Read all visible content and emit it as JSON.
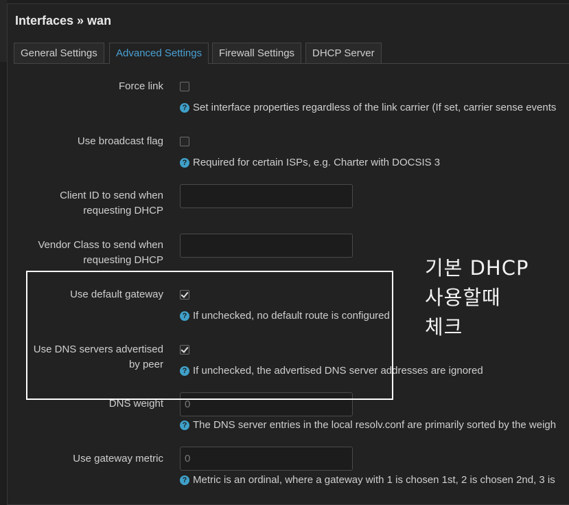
{
  "dialog": {
    "title": "Interfaces » wan"
  },
  "tabs": [
    {
      "label": "General Settings",
      "active": false
    },
    {
      "label": "Advanced Settings",
      "active": true
    },
    {
      "label": "Firewall Settings",
      "active": false
    },
    {
      "label": "DHCP Server",
      "active": false
    }
  ],
  "fields": {
    "force_link": {
      "label": "Force link",
      "checked": false,
      "help": "Set interface properties regardless of the link carrier (If set, carrier sense events"
    },
    "broadcast_flag": {
      "label": "Use broadcast flag",
      "checked": false,
      "help": "Required for certain ISPs, e.g. Charter with DOCSIS 3"
    },
    "client_id": {
      "label_line1": "Client ID to send when",
      "label_line2": "requesting DHCP",
      "value": ""
    },
    "vendor_class": {
      "label_line1": "Vendor Class to send when",
      "label_line2": "requesting DHCP",
      "value": ""
    },
    "default_gateway": {
      "label": "Use default gateway",
      "checked": true,
      "help": "If unchecked, no default route is configured"
    },
    "peer_dns": {
      "label_line1": "Use DNS servers advertised",
      "label_line2": "by peer",
      "checked": true,
      "help": "If unchecked, the advertised DNS server addresses are ignored"
    },
    "dns_weight": {
      "label": "DNS weight",
      "placeholder": "0",
      "help": "The DNS server entries in the local resolv.conf are primarily sorted by the weigh"
    },
    "gateway_metric": {
      "label": "Use gateway metric",
      "placeholder": "0",
      "help": "Metric is an ordinal, where a gateway with 1 is chosen 1st, 2 is chosen 2nd, 3 is"
    }
  },
  "annotation": {
    "line1": "기본 DHCP",
    "line2": "사용할때",
    "line3": "체크"
  },
  "colors": {
    "accent": "#49a0d2",
    "help_icon": "#3fa0c9",
    "highlight_box": "#ffffff"
  }
}
